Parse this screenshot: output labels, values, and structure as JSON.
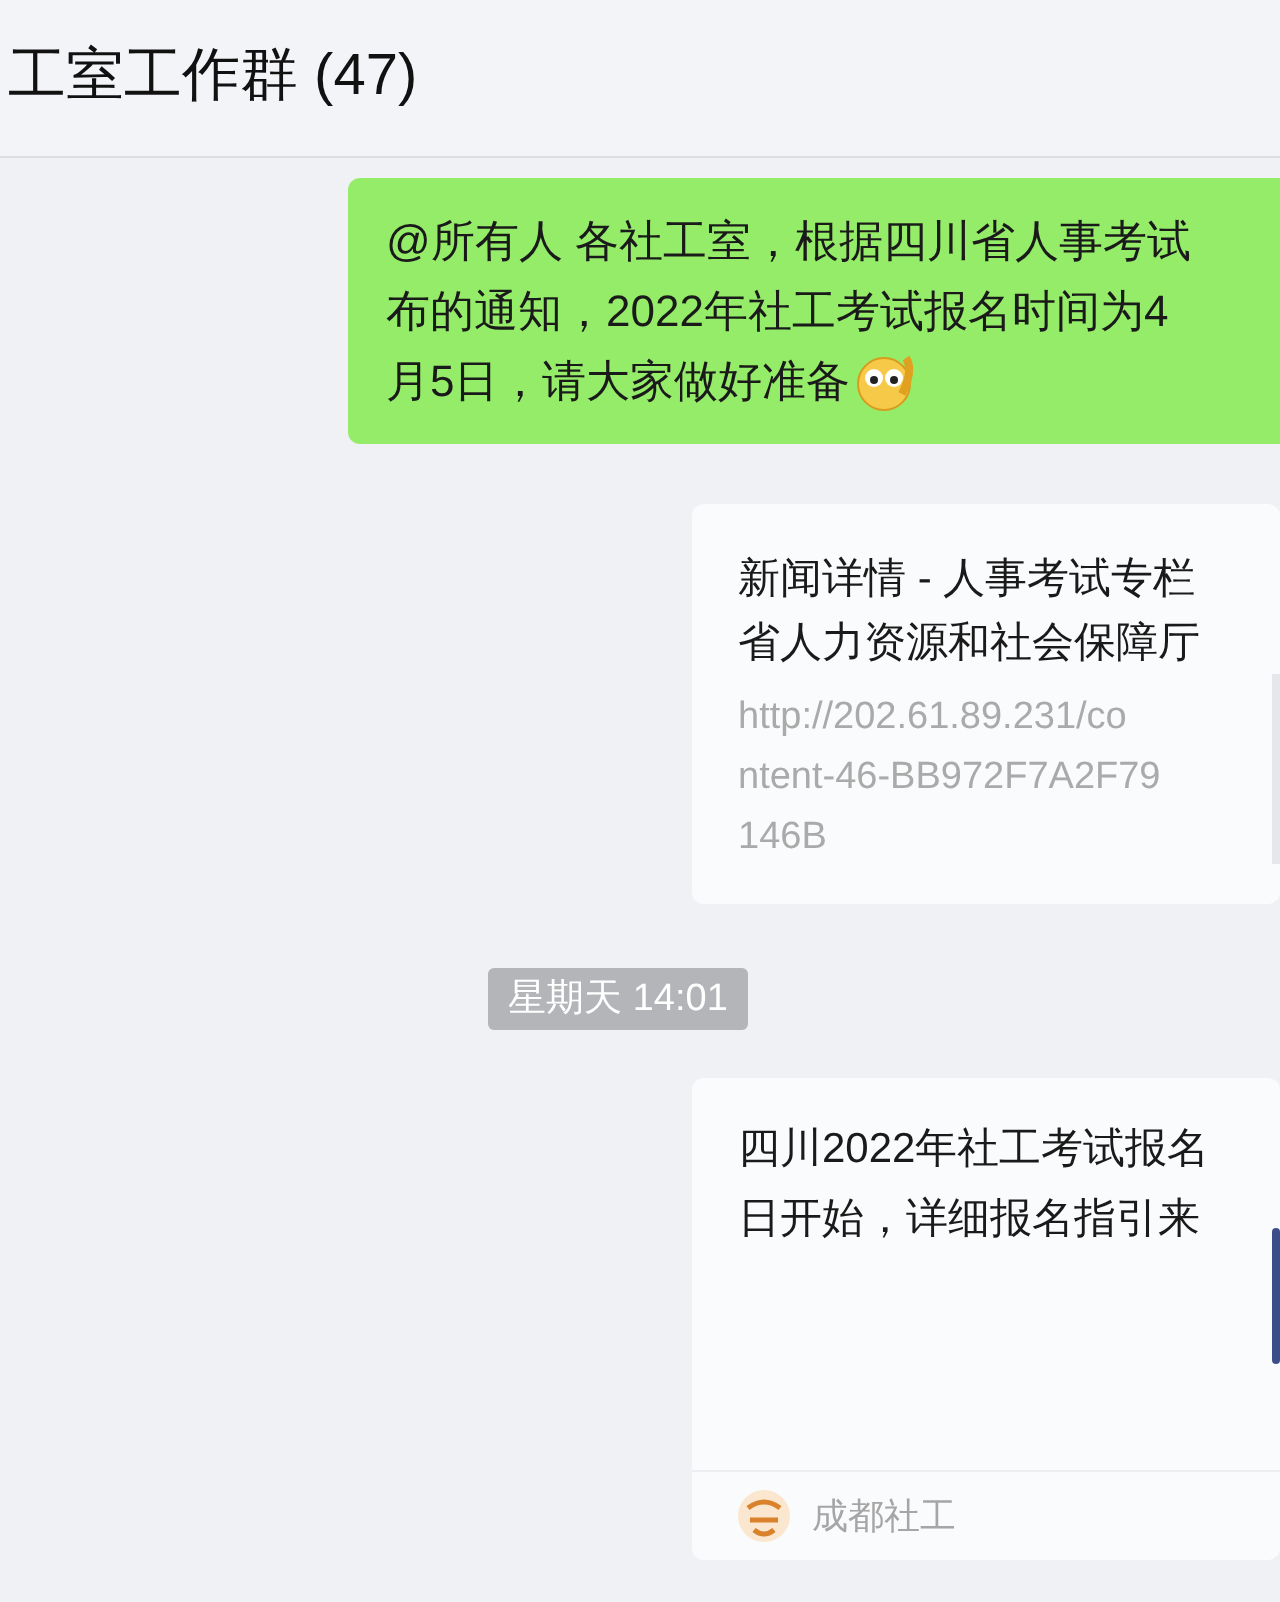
{
  "header": {
    "title": "工室工作群 (47)"
  },
  "messages": [
    {
      "kind": "text",
      "lines": [
        "@所有人 各社工室，根据四川省人事考试",
        "布的通知，2022年社工考试报名时间为4",
        "月5日，请大家做好准备"
      ],
      "emoji": true
    },
    {
      "kind": "link",
      "title_lines": [
        "新闻详情 - 人事考试专栏",
        "省人力资源和社会保障厅"
      ],
      "url_lines": [
        "http://202.61.89.231/co",
        "ntent-46-BB972F7A2F79",
        "146B"
      ]
    },
    {
      "kind": "time",
      "text": "星期天 14:01"
    },
    {
      "kind": "article",
      "title_lines": [
        "四川2022年社工考试报名",
        "日开始，详细报名指引来"
      ],
      "source": "成都社工"
    }
  ]
}
